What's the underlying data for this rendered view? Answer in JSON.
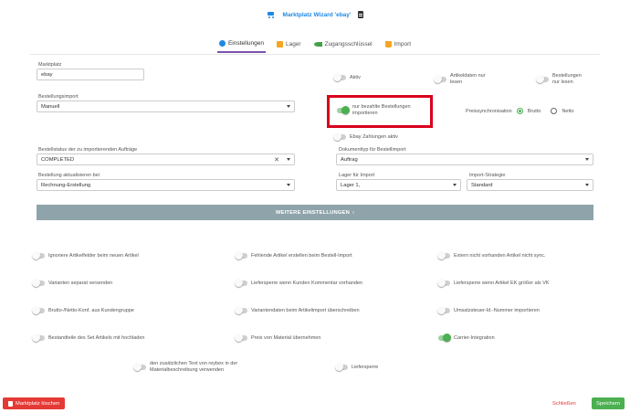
{
  "header": {
    "title": "Marktplatz Wizard 'ebay'",
    "cart_icon": "shopping-cart-icon",
    "doc_icon": "document-icon"
  },
  "tabs": [
    {
      "label": "Einstellungen",
      "icon": "gear-icon",
      "active": true
    },
    {
      "label": "Lager",
      "icon": "truck-icon",
      "active": false
    },
    {
      "label": "Zugangsschlüssel",
      "icon": "key-icon",
      "active": false
    },
    {
      "label": "Import",
      "icon": "import-icon",
      "active": false
    }
  ],
  "form": {
    "marktplatz": {
      "label": "Marktplatz",
      "value": "ebay"
    },
    "bestellungsimport": {
      "label": "Bestellungsimport",
      "value": "Manuell"
    },
    "bestellstatus": {
      "label": "Bestellstatus der zu importierenden Aufträge",
      "value": "COMPLETED"
    },
    "bestellung_aktualisieren": {
      "label": "Bestellung aktualisieren bei",
      "value": "Rechnung-Erstellung"
    },
    "dokumenttyp": {
      "label": "Dokumenttyp für Bestellimport",
      "value": "Auftrag"
    },
    "lager_import": {
      "label": "Lager für Import",
      "value": "Lager 1,"
    },
    "import_strategie": {
      "label": "Import-Strategie",
      "value": "Standard"
    }
  },
  "toggles_top": {
    "aktiv": {
      "label": "Aktiv",
      "on": false
    },
    "artikeldaten": {
      "label": "Artikeldaten nur lesen",
      "line1": "Artikeldaten nur",
      "line2": "lesen",
      "on": false
    },
    "bestellungen_lesen": {
      "label": "Bestellungen nur lesen",
      "line1": "Bestellungen",
      "line2": "nur lesen",
      "on": false
    },
    "nur_bezahlte": {
      "label": "nur bezahlte Bestellungen importieren",
      "line1": "nur bezahlte Bestellungen",
      "line2": "importieren",
      "on": true
    },
    "ebay_zahlungen": {
      "label": "Ebay Zahlungen aktiv",
      "on": false
    }
  },
  "preissync": {
    "label": "Preissynchronisation",
    "options": [
      "Brutto",
      "Netto"
    ],
    "selected": "Brutto"
  },
  "more_button": "WEITERE EINSTELLUNGEN",
  "options": [
    {
      "label": "Ignoriere Artikelfelder beim neuen Artikel",
      "on": false
    },
    {
      "label": "Fehlende Artikel erstellen beim Bestell-Import",
      "on": false
    },
    {
      "label": "Extern nicht vorhanden Artikel nicht sync.",
      "on": false
    },
    {
      "label": "Varianten separat versenden",
      "on": false
    },
    {
      "label": "Liefersperre wenn Kunden Kommentar vorhanden",
      "on": false
    },
    {
      "label": "Liefersperre wenn Artikel EK größer als VK",
      "on": false
    },
    {
      "label": "Brutto-/Netto-Konf. aus Kundengruppe",
      "on": false
    },
    {
      "label": "Variantendaten beim Artikelimport überschreiben",
      "on": false
    },
    {
      "label": "Umsatzsteuer-Id.-Nummer importieren",
      "on": false
    },
    {
      "label": "Bestandteile des Set Artikels mit hochladen",
      "on": false
    },
    {
      "label": "Preis von Material übernehmen",
      "on": false
    },
    {
      "label": "Carrier-Integration",
      "on": true
    },
    {
      "label": "den zusätzlichen Text von reybex in der Materialbeschreibung verwenden",
      "line1": "den zusätzlichen Text von reybex in der",
      "line2": "Materialbeschreibung verwenden",
      "on": false
    },
    {
      "label": "Liefersperre",
      "on": false
    }
  ],
  "footer": {
    "delete": "Marktplatz löschen",
    "close": "Schließen",
    "save": "Speichern"
  },
  "colors": {
    "accent_blue": "#1e88e5",
    "tab_underline": "#7b52ab",
    "toggle_on": "#4caf50",
    "highlight_box": "#d9001b",
    "delete": "#e53935",
    "save": "#4caf50",
    "more_button": "#8fa3ab"
  }
}
